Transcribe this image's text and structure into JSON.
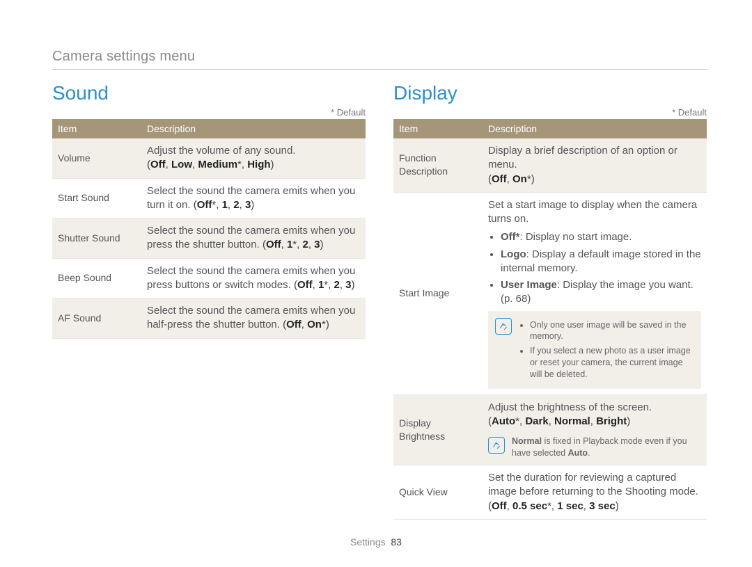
{
  "breadcrumb": "Camera settings menu",
  "default_note": "* Default",
  "table_header": {
    "item": "Item",
    "desc": "Description"
  },
  "sound": {
    "title": "Sound",
    "rows": [
      {
        "item": "Volume",
        "desc": "Adjust the volume of any sound.",
        "options": "(Off, Low, Medium*, High)"
      },
      {
        "item": "Start Sound",
        "desc": "Select the sound the camera emits when you turn it on. ",
        "options_inline": "(Off*, 1, 2, 3)"
      },
      {
        "item": "Shutter Sound",
        "desc": "Select the sound the camera emits when you press the shutter button. ",
        "options_inline": "(Off, 1*, 2, 3)"
      },
      {
        "item": "Beep Sound",
        "desc": "Select the sound the camera emits when you press buttons or switch modes. ",
        "options_inline": "(Off, 1*, 2, 3)"
      },
      {
        "item": "AF Sound",
        "desc": "Select the sound the camera emits when you half-press the shutter button. ",
        "options_inline": "(Off, On*)"
      }
    ]
  },
  "display": {
    "title": "Display",
    "rows": {
      "func_desc": {
        "item": "Function Description",
        "desc": "Display a brief description of an option or menu.",
        "options": "(Off, On*)"
      },
      "start_image": {
        "item": "Start Image",
        "desc": "Set a start image to display when the camera turns on.",
        "bullets": {
          "off_strong": "Off*",
          "off_rest": ": Display no start image.",
          "logo_strong": "Logo",
          "logo_rest": ": Display a default image stored in the internal memory.",
          "user_strong": "User Image",
          "user_rest": ": Display the image you want. (p. 68)"
        },
        "note1": "Only one user image will be saved in the memory.",
        "note2": "If you select a new photo as a user image or reset your camera, the current image will be deleted."
      },
      "brightness": {
        "item": "Display Brightness",
        "desc": "Adjust the brightness of the screen.",
        "options": "(Auto*, Dark, Normal, Bright)",
        "note_pre": "Normal",
        "note_mid": " is fixed in Playback mode even if you have selected ",
        "note_post": "Auto",
        "note_end": "."
      },
      "quick_view": {
        "item": "Quick View",
        "desc": "Set the duration for reviewing a captured image before returning to the Shooting mode.",
        "options": "(Off, 0.5 sec*, 1 sec, 3 sec)"
      }
    }
  },
  "footer": {
    "section": "Settings",
    "page": "83"
  }
}
